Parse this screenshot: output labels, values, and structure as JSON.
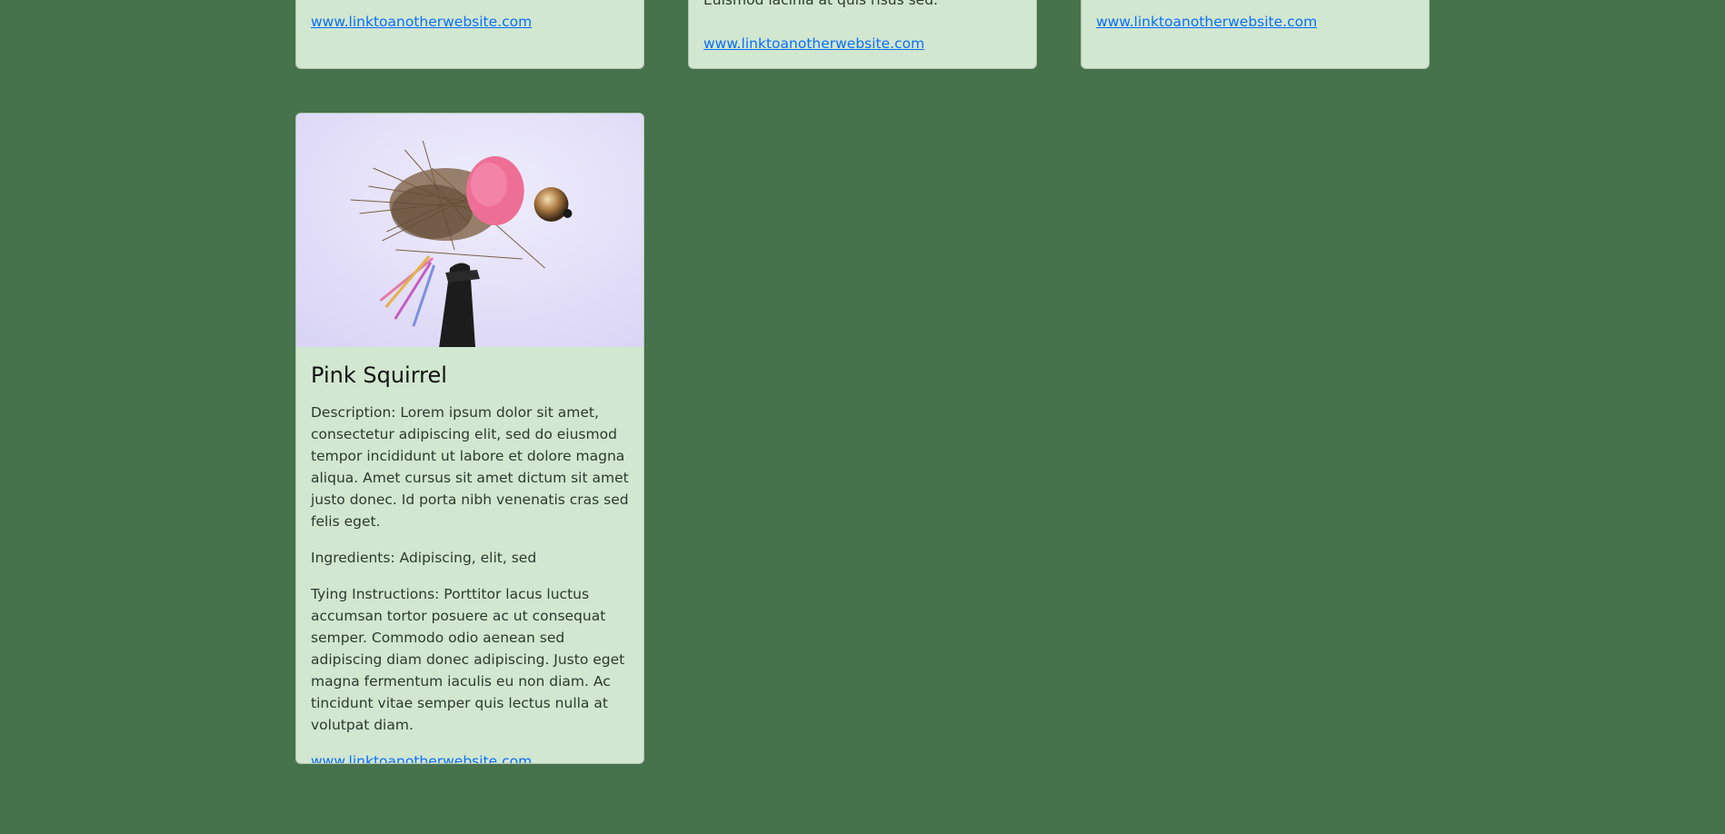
{
  "cards_top": [
    {
      "link": "www.linktoanotherwebsite.com"
    },
    {
      "text": "Euismod lacinia at quis risus sed.",
      "link": "www.linktoanotherwebsite.com"
    },
    {
      "link": "www.linktoanotherwebsite.com"
    }
  ],
  "main_card": {
    "title": "Pink Squirrel",
    "description": "Description: Lorem ipsum dolor sit amet, consectetur adipiscing elit, sed do eiusmod tempor incididunt ut labore et dolore magna aliqua. Amet cursus sit amet dictum sit amet justo donec. Id porta nibh venenatis cras sed felis eget.",
    "ingredients": "Ingredients: Adipiscing, elit, sed",
    "instructions": "Tying Instructions: Porttitor lacus luctus accumsan tortor posuere ac ut consequat semper. Commodo odio aenean sed adipiscing diam donec adipiscing. Justo eget magna fermentum iaculis eu non diam. Ac tincidunt vitae semper quis lectus nulla at volutpat diam.",
    "link": "www.linktoanotherwebsite.com",
    "image_alt": "fly-photo-pink-squirrel"
  },
  "colors": {
    "background": "#46724c",
    "card": "#d1e7d0",
    "link": "#0d6efd"
  }
}
